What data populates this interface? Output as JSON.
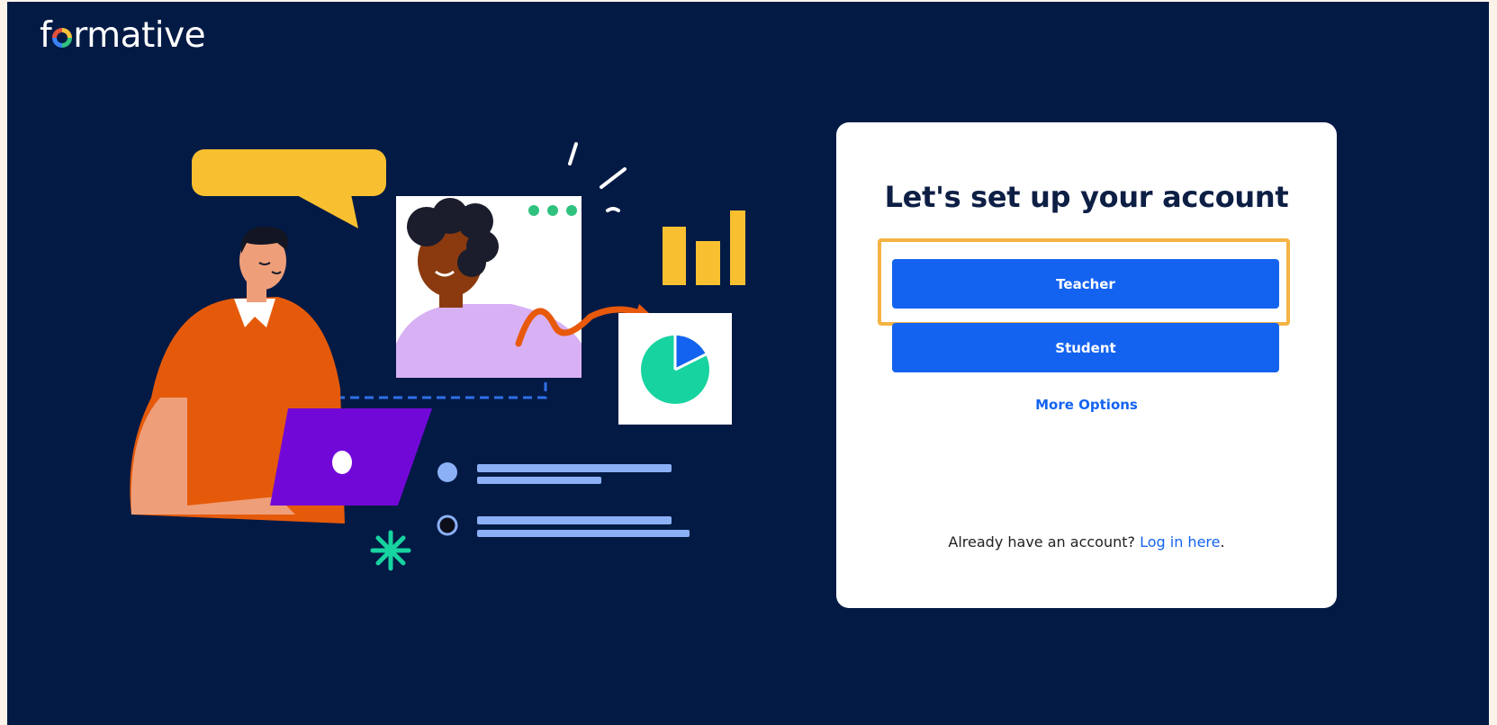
{
  "brand": {
    "logo_prefix": "f",
    "logo_suffix": "rmative"
  },
  "colors": {
    "background": "#031a45",
    "primary": "#1463f0",
    "highlight": "#f5b344",
    "card": "#ffffff"
  },
  "card": {
    "title": "Let's set up your account",
    "buttons": {
      "teacher": "Teacher",
      "student": "Student"
    },
    "more_options": "More Options",
    "footer_text": "Already have an account?",
    "login_link": "Log in here",
    "login_suffix": "."
  }
}
